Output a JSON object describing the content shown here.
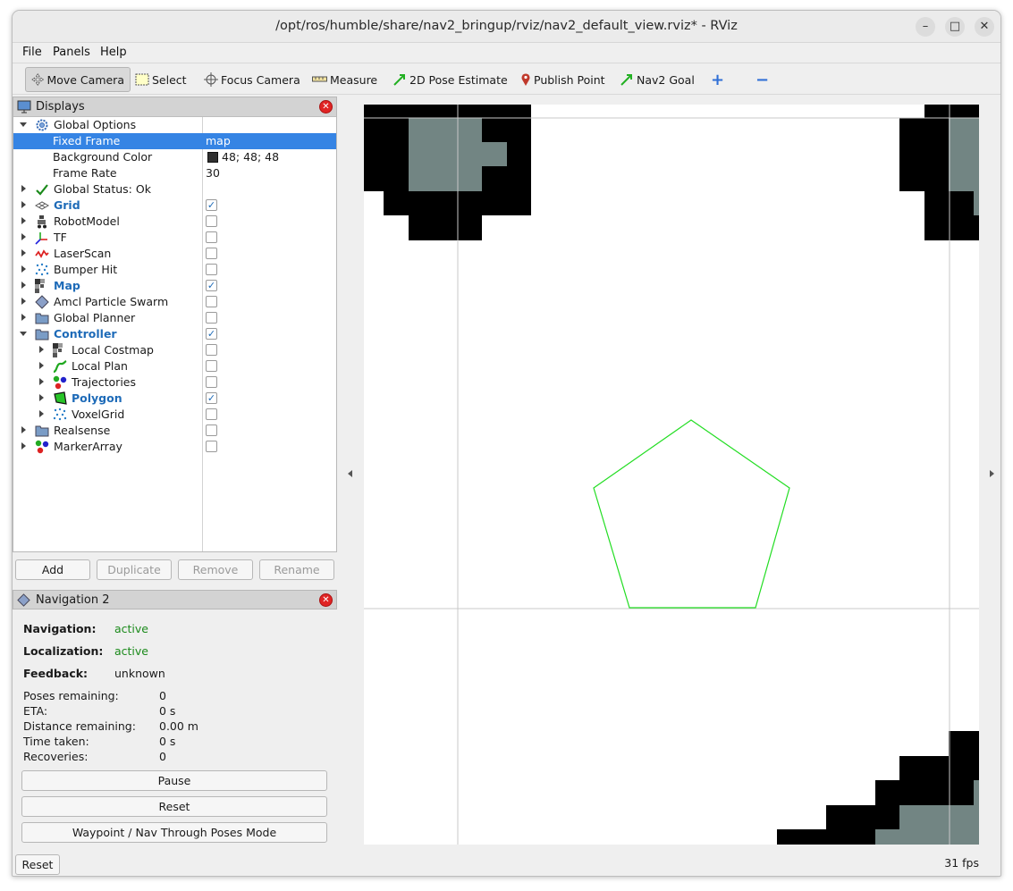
{
  "window": {
    "title": "/opt/ros/humble/share/nav2_bringup/rviz/nav2_default_view.rviz* - RViz",
    "minimize_glyph": "–",
    "maximize_glyph": "□",
    "close_glyph": "✕"
  },
  "menu": {
    "file": "File",
    "panels": "Panels",
    "help": "Help"
  },
  "toolbar": {
    "move_camera": "Move Camera",
    "select": "Select",
    "focus_camera": "Focus Camera",
    "measure": "Measure",
    "pose_estimate": "2D Pose Estimate",
    "publish_point": "Publish Point",
    "nav2_goal": "Nav2 Goal",
    "add_tool_glyph": "+",
    "remove_tool_glyph": "−"
  },
  "displays": {
    "title": "Displays",
    "close_glyph": "✕",
    "global_options": "Global Options",
    "fixed_frame_label": "Fixed Frame",
    "fixed_frame_value": "map",
    "background_color_label": "Background Color",
    "background_color_value": "48; 48; 48",
    "background_color_hex": "#303030",
    "frame_rate_label": "Frame Rate",
    "frame_rate_value": "30",
    "global_status": "Global Status: Ok",
    "items": {
      "grid": "Grid",
      "robot_model": "RobotModel",
      "tf": "TF",
      "laser_scan": "LaserScan",
      "bumper_hit": "Bumper Hit",
      "map": "Map",
      "amcl": "Amcl Particle Swarm",
      "global_planner": "Global Planner",
      "controller": "Controller",
      "local_costmap": "Local Costmap",
      "local_plan": "Local Plan",
      "trajectories": "Trajectories",
      "polygon": "Polygon",
      "voxel_grid": "VoxelGrid",
      "realsense": "Realsense",
      "marker_array": "MarkerArray"
    },
    "check_glyph": "✓"
  },
  "display_buttons": {
    "add": "Add",
    "duplicate": "Duplicate",
    "remove": "Remove",
    "rename": "Rename"
  },
  "nav2": {
    "title": "Navigation 2",
    "close_glyph": "✕",
    "navigation_label": "Navigation:",
    "navigation_value": "active",
    "localization_label": "Localization:",
    "localization_value": "active",
    "feedback_label": "Feedback:",
    "feedback_value": "unknown",
    "poses_remaining_label": "Poses remaining:",
    "poses_remaining_value": "0",
    "eta_label": "ETA:",
    "eta_value": "0 s",
    "distance_label": "Distance remaining:",
    "distance_value": "0.00 m",
    "time_label": "Time taken:",
    "time_value": "0 s",
    "recoveries_label": "Recoveries:",
    "recoveries_value": "0",
    "pause_button": "Pause",
    "reset_button": "Reset",
    "waypoint_button": "Waypoint / Nav Through Poses Mode"
  },
  "status": {
    "reset_button": "Reset",
    "fps": "31 fps"
  },
  "colors": {
    "selection": "#3584e4",
    "polygon_stroke": "#22dd22",
    "occupied": "#000000",
    "unknown": "#728583",
    "free": "#ffffff",
    "active_text": "#1b8a1b",
    "enabled_label": "#1e6bb8"
  }
}
